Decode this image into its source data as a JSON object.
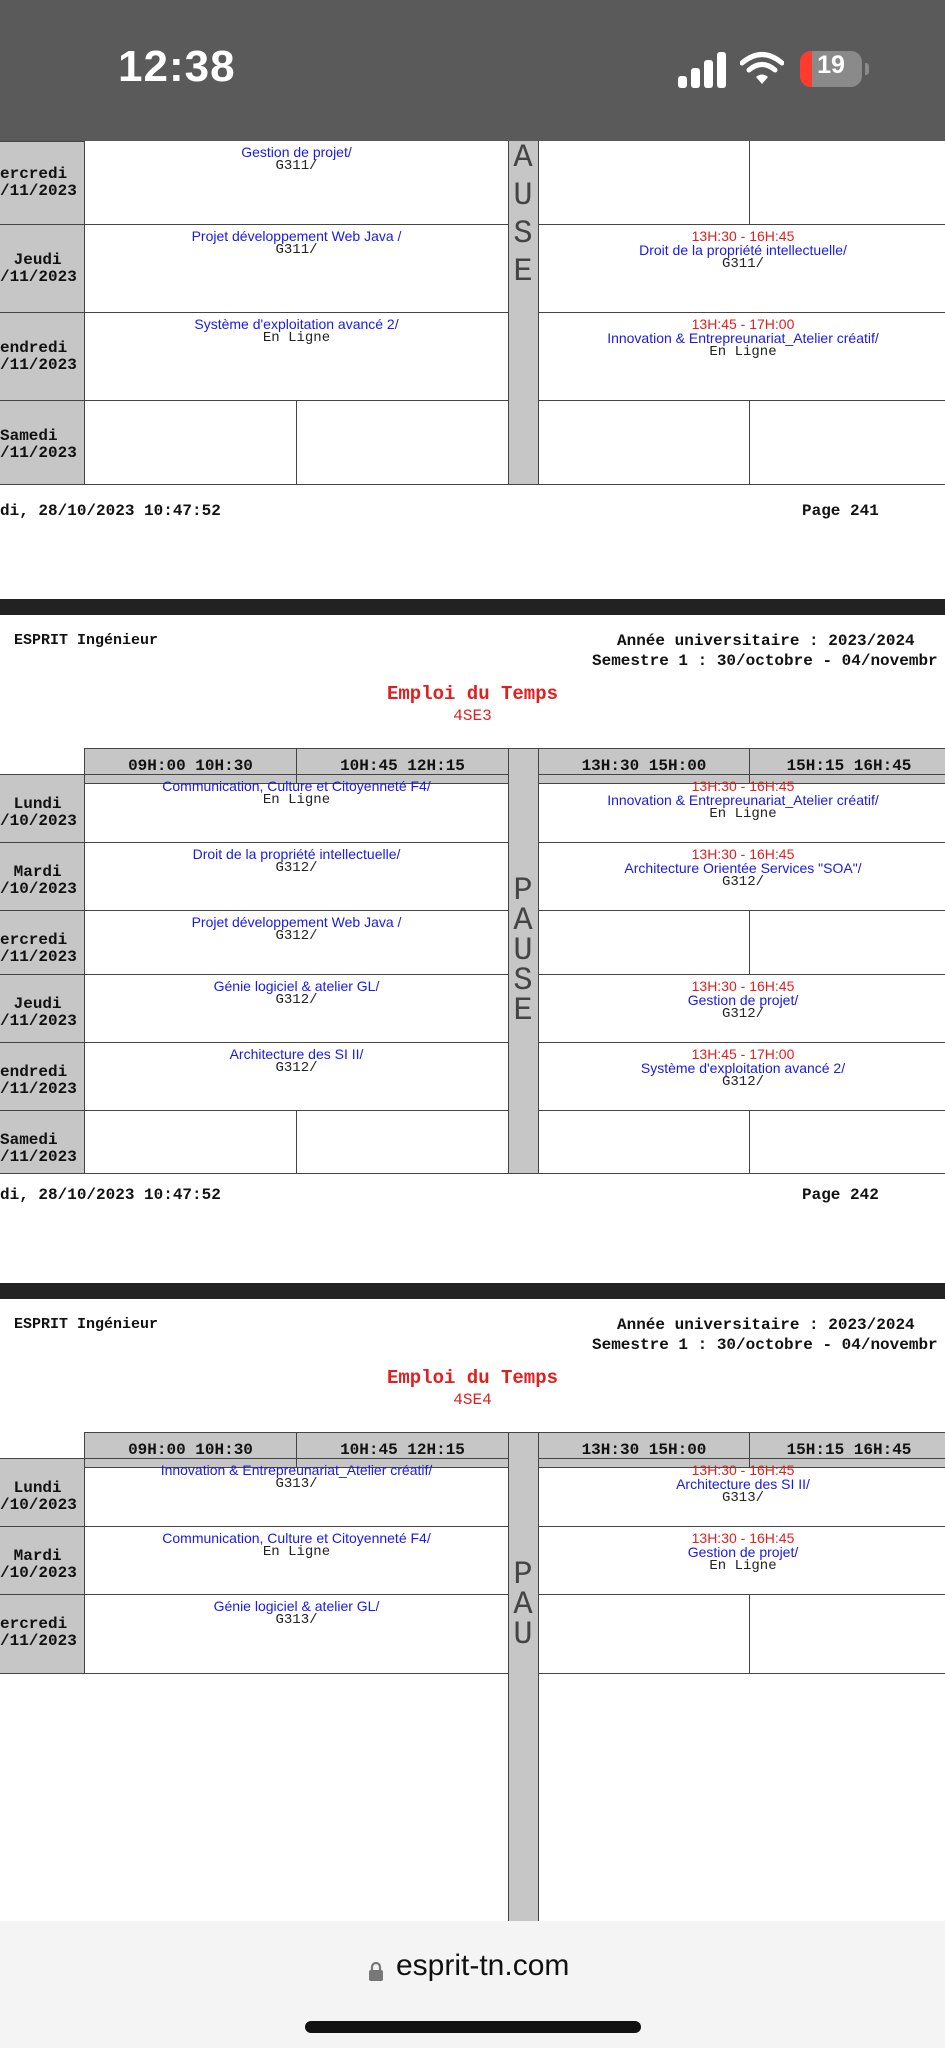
{
  "status": {
    "time": "12:38",
    "battery": "19",
    "battery_level": 0.19
  },
  "section1": {
    "days": [
      {
        "name": "ercredi",
        "date": "/11/2023"
      },
      {
        "name": "Jeudi",
        "date": "/11/2023"
      },
      {
        "name": "endredi",
        "date": "/11/2023"
      },
      {
        "name": "Samedi",
        "date": "/11/2023"
      }
    ],
    "pause": [
      "A",
      "U",
      "S",
      "E"
    ],
    "courses": [
      {
        "time": "",
        "name": "Gestion de projet/",
        "room": "G311/"
      },
      {
        "time": "13H:30 - 16H:45",
        "name": "Droit de la propriété intellectuelle/",
        "room": "G311/"
      },
      {
        "time": "",
        "name": "Projet développement Web Java /",
        "room": "G311/"
      },
      {
        "time": "",
        "name": "Système d'exploitation avancé 2/",
        "room": "En Ligne"
      },
      {
        "time": "13H:45 - 17H:00",
        "name": "Innovation & Entrepreunariat_Atelier créatif/",
        "room": "En Ligne"
      }
    ],
    "footer_left": "di, 28/10/2023 10:47:52",
    "footer_right": "Page 241"
  },
  "section2": {
    "school": "ESPRIT Ingénieur",
    "year": "Année universitaire : 2023/2024",
    "semester": "Semestre 1 : 30/octobre - 04/novembr",
    "title": "Emploi du Temps",
    "class_name": "4SE3",
    "headers": [
      "09H:00 10H:30",
      "10H:45 12H:15",
      "13H:30 15H:00",
      "15H:15 16H:45"
    ],
    "days": [
      {
        "name": "Lundi",
        "date": "/10/2023"
      },
      {
        "name": "Mardi",
        "date": "/10/2023"
      },
      {
        "name": "ercredi",
        "date": "/11/2023"
      },
      {
        "name": "Jeudi",
        "date": "/11/2023"
      },
      {
        "name": "endredi",
        "date": "/11/2023"
      },
      {
        "name": "Samedi",
        "date": "/11/2023"
      }
    ],
    "pause": [
      "P",
      "A",
      "U",
      "S",
      "E"
    ],
    "courses": [
      {
        "time": "",
        "name": "Communication, Culture et Citoyenneté  F4/",
        "room": "En Ligne"
      },
      {
        "time": "13H:30 - 16H:45",
        "name": "Innovation & Entrepreunariat_Atelier créatif/",
        "room": "En Ligne"
      },
      {
        "time": "",
        "name": "Droit de la propriété intellectuelle/",
        "room": "G312/"
      },
      {
        "time": "13H:30 - 16H:45",
        "name": "Architecture Orientée Services \"SOA\"/",
        "room": "G312/"
      },
      {
        "time": "",
        "name": "Projet développement Web Java /",
        "room": "G312/"
      },
      {
        "time": "",
        "name": "Génie logiciel & atelier GL/",
        "room": "G312/"
      },
      {
        "time": "13H:30 - 16H:45",
        "name": "Gestion de projet/",
        "room": "G312/"
      },
      {
        "time": "",
        "name": "Architecture des SI II/",
        "room": "G312/"
      },
      {
        "time": "13H:45 - 17H:00",
        "name": "Système d'exploitation avancé 2/",
        "room": "G312/"
      }
    ],
    "footer_left": "di, 28/10/2023 10:47:52",
    "footer_right": "Page 242"
  },
  "section3": {
    "school": "ESPRIT Ingénieur",
    "year": "Année universitaire : 2023/2024",
    "semester": "Semestre 1 : 30/octobre - 04/novembr",
    "title": "Emploi du Temps",
    "class_name": "4SE4",
    "headers": [
      "09H:00 10H:30",
      "10H:45 12H:15",
      "13H:30 15H:00",
      "15H:15 16H:45"
    ],
    "days": [
      {
        "name": "Lundi",
        "date": "/10/2023"
      },
      {
        "name": "Mardi",
        "date": "/10/2023"
      },
      {
        "name": "ercredi",
        "date": "/11/2023"
      }
    ],
    "pause": [
      "P",
      "A",
      "U"
    ],
    "courses": [
      {
        "time": "",
        "name": "Innovation & Entrepreunariat_Atelier créatif/",
        "room": "G313/"
      },
      {
        "time": "13H:30 - 16H:45",
        "name": "Architecture des SI II/",
        "room": "G313/"
      },
      {
        "time": "",
        "name": "Communication, Culture et Citoyenneté  F4/",
        "room": "En Ligne"
      },
      {
        "time": "13H:30 - 16H:45",
        "name": "Gestion de projet/",
        "room": "En Ligne"
      },
      {
        "time": "",
        "name": "Génie logiciel & atelier GL/",
        "room": "G313/"
      }
    ]
  },
  "url_bar": {
    "domain": "esprit-tn.com",
    "lock_icon": "lock-icon"
  }
}
